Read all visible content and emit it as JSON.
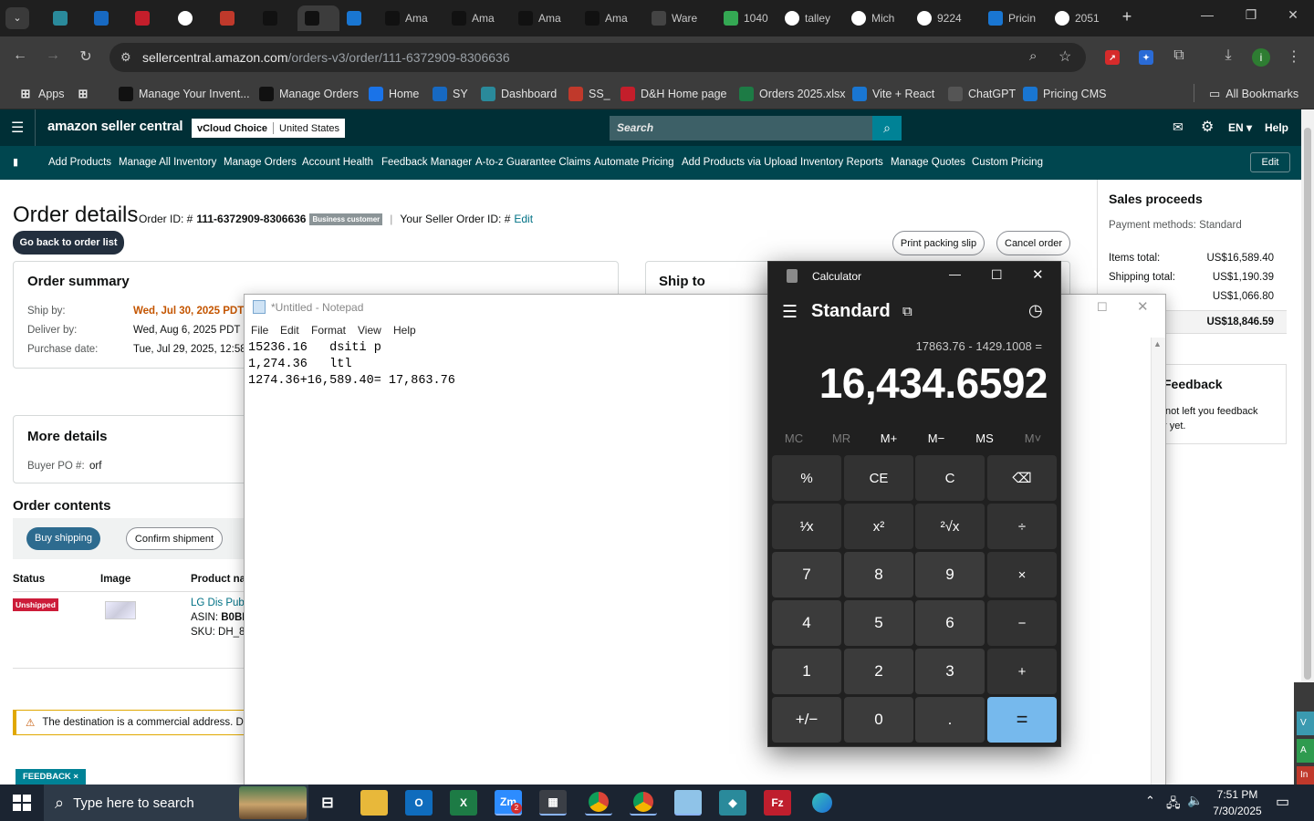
{
  "browser": {
    "tabs": [
      {
        "label": "",
        "icon": "tab-search-icon"
      },
      {
        "label": "",
        "icon": "diamond-icon"
      },
      {
        "label": "",
        "icon": "ec-icon"
      },
      {
        "label": "",
        "icon": "dh-icon"
      },
      {
        "label": "",
        "icon": "g-doc-icon"
      },
      {
        "label": "",
        "icon": "package-icon"
      },
      {
        "label": "",
        "icon": "amazon-icon"
      },
      {
        "label": "",
        "icon": "amazon-icon"
      },
      {
        "label": "",
        "icon": "dollar-icon"
      },
      {
        "label": "Ama",
        "icon": "amazon-icon"
      },
      {
        "label": "Ama",
        "icon": "amazon-icon"
      },
      {
        "label": "Ama",
        "icon": "amazon-icon"
      },
      {
        "label": "Ama",
        "icon": "amazon-icon"
      },
      {
        "label": "Ware",
        "icon": "openai-icon"
      },
      {
        "label": "1040",
        "icon": "maps-icon"
      },
      {
        "label": "talley",
        "icon": "google-icon"
      },
      {
        "label": "Mich",
        "icon": "google-icon"
      },
      {
        "label": "9224",
        "icon": "google-icon"
      },
      {
        "label": "Pricin",
        "icon": "dollar-icon"
      },
      {
        "label": "2051",
        "icon": "google-icon"
      }
    ],
    "new_tab": "+",
    "url_domain": "sellercentral.amazon.com",
    "url_path": "/orders-v3/order/111-6372909-8306636",
    "bookmarks": [
      {
        "label": "Apps"
      },
      {
        "label": ""
      },
      {
        "label": "Manage Your Invent..."
      },
      {
        "label": "Manage Orders"
      },
      {
        "label": "Home"
      },
      {
        "label": "SY"
      },
      {
        "label": "Dashboard"
      },
      {
        "label": "SS_"
      },
      {
        "label": "D&H Home page"
      },
      {
        "label": "Orders 2025.xlsx"
      },
      {
        "label": "Vite + React"
      },
      {
        "label": "ChatGPT"
      },
      {
        "label": "Pricing CMS"
      }
    ],
    "all_bookmarks": "All Bookmarks",
    "profile_initial": "i"
  },
  "amazon": {
    "logo": "amazon seller central",
    "store_name": "vCloud Choice",
    "marketplace": "United States",
    "search_placeholder": "Search",
    "lang": "EN",
    "help": "Help",
    "nav": [
      "Add Products",
      "Manage All Inventory",
      "Manage Orders",
      "Account Health",
      "Feedback Manager",
      "A-to-z Guarantee Claims",
      "Automate Pricing",
      "Add Products via Upload",
      "Inventory Reports",
      "Manage Quotes",
      "Custom Pricing"
    ],
    "edit": "Edit"
  },
  "order": {
    "title": "Order details",
    "order_id_label": "Order ID: #",
    "order_id": "111-6372909-8306636",
    "business_badge": "Business customer",
    "seller_order_label": "Your Seller Order ID: #",
    "seller_order_edit": "Edit",
    "back_button": "Go back to order list",
    "print_button": "Print packing slip",
    "cancel_button": "Cancel order",
    "summary_title": "Order summary",
    "ship_by_label": "Ship by:",
    "ship_by": "Wed, Jul 30, 2025 PDT",
    "deliver_by_label": "Deliver by:",
    "deliver_by": "Wed, Aug 6, 2025 PDT",
    "purchase_label": "Purchase date:",
    "purchase": "Tue, Jul 29, 2025, 12:58",
    "ship_to_title": "Ship to",
    "more_details_title": "More details",
    "buyer_po_label": "Buyer PO #:",
    "buyer_po": "orf",
    "contents_title": "Order contents",
    "buy_shipping": "Buy shipping",
    "confirm_shipment": "Confirm shipment",
    "col_status": "Status",
    "col_image": "Image",
    "col_product": "Product na",
    "status_badge": "Unshipped",
    "product_name": "LG Dis Publ",
    "asin_label": "ASIN:",
    "asin": "B0BK",
    "sku_label": "SKU:",
    "sku": "DH_8(",
    "warning": "The destination is a commercial address. De",
    "feedback_tab": "FEEDBACK",
    "feedback_close": "×"
  },
  "proceeds": {
    "title": "Sales proceeds",
    "payment": "Payment methods: Standard",
    "items_label": "Items total:",
    "items": "US$16,589.40",
    "shipping_label": "Shipping total:",
    "shipping": "US$1,190.39",
    "tax": "US$1,066.80",
    "total_label": ":",
    "total": "US$18,846.59",
    "feedback_title": "Feedback",
    "feedback_text_1": "not left you feedback",
    "feedback_text_2": "r yet."
  },
  "notepad": {
    "title": "*Untitled - Notepad",
    "menu": [
      "File",
      "Edit",
      "Format",
      "View",
      "Help"
    ],
    "line1": "15236.16   dsiti p",
    "line2": "1,274.36   ltl",
    "line3": "1274.36+16,589.40= 17,863.76"
  },
  "calculator": {
    "title": "Calculator",
    "mode": "Standard",
    "expression": "17863.76 - 1429.1008 =",
    "result": "16,434.6592",
    "memory": [
      "MC",
      "MR",
      "M+",
      "M−",
      "MS",
      "M˅"
    ],
    "keys": [
      [
        "%",
        "CE",
        "C",
        "⌫"
      ],
      [
        "¹⁄x",
        "x²",
        "²√x",
        "÷"
      ],
      [
        "7",
        "8",
        "9",
        "×"
      ],
      [
        "4",
        "5",
        "6",
        "−"
      ],
      [
        "1",
        "2",
        "3",
        "+"
      ],
      [
        "+/−",
        "0",
        ".",
        "="
      ]
    ]
  },
  "taskbar": {
    "search_placeholder": "Type here to search",
    "time": "7:51 PM",
    "date": "7/30/2025",
    "zoom_badge": "2"
  }
}
